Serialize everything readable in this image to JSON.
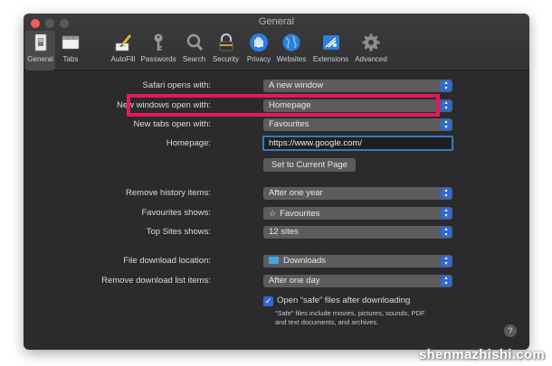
{
  "window": {
    "title": "General"
  },
  "toolbar": {
    "tabs": [
      {
        "label": "General",
        "icon": "general-switch-icon"
      },
      {
        "label": "Tabs",
        "icon": "tabs-icon"
      },
      {
        "label": "AutoFill",
        "icon": "autofill-pencil-icon"
      },
      {
        "label": "Passwords",
        "icon": "key-icon"
      },
      {
        "label": "Search",
        "icon": "magnifier-icon"
      },
      {
        "label": "Security",
        "icon": "lock-icon"
      },
      {
        "label": "Privacy",
        "icon": "hand-icon"
      },
      {
        "label": "Websites",
        "icon": "globe-icon"
      },
      {
        "label": "Extensions",
        "icon": "puzzle-icon"
      },
      {
        "label": "Advanced",
        "icon": "gear-icon"
      }
    ]
  },
  "settings": {
    "safari_opens_with": {
      "label": "Safari opens with:",
      "value": "A new window"
    },
    "new_windows_open_with": {
      "label": "New windows open with:",
      "value": "Homepage"
    },
    "new_tabs_open_with": {
      "label": "New tabs open with:",
      "value": "Favourites"
    },
    "homepage": {
      "label": "Homepage:",
      "value": "https://www.google.com/"
    },
    "set_current_page": "Set to Current Page",
    "remove_history": {
      "label": "Remove history items:",
      "value": "After one year"
    },
    "favourites_shows": {
      "label": "Favourites shows:",
      "value": "Favourites",
      "icon": "star-icon"
    },
    "top_sites_shows": {
      "label": "Top Sites shows:",
      "value": "12 sites"
    },
    "download_location": {
      "label": "File download location:",
      "value": "Downloads",
      "icon": "folder-icon"
    },
    "remove_download_items": {
      "label": "Remove download list items:",
      "value": "After one day"
    },
    "open_safe_files": {
      "label": "Open “safe” files after downloading",
      "checked": true,
      "note": "“Safe” files include movies, pictures, sounds, PDF and text documents, and archives."
    }
  },
  "help": "?",
  "watermark": "shenmazhishi.com",
  "colors": {
    "highlight": "#e3185f",
    "accent": "#2f6ad4"
  }
}
